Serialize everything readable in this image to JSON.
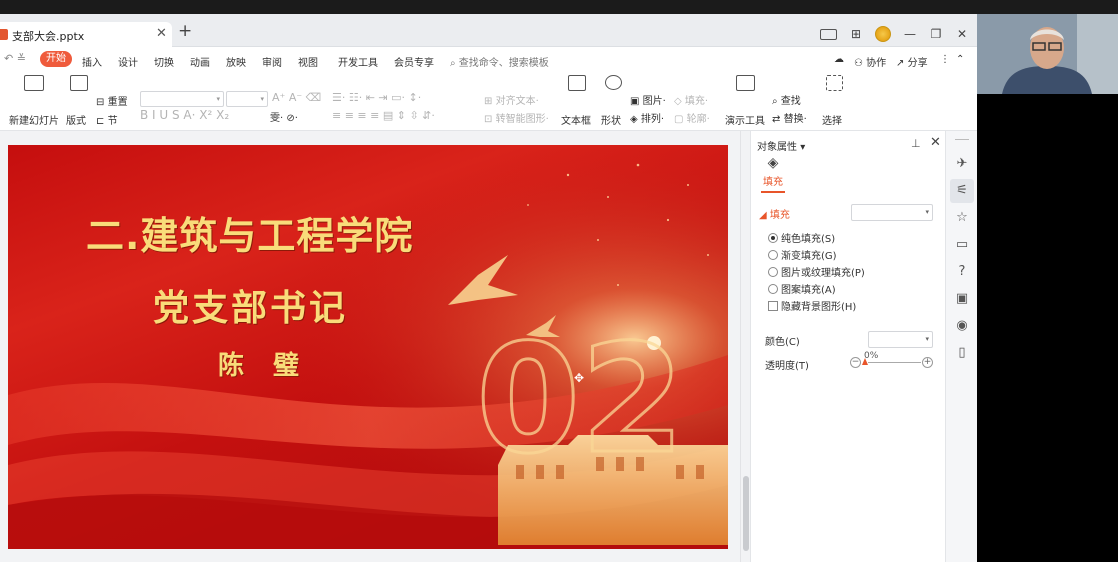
{
  "app": {
    "accent": "#ef5b3c",
    "slide_red": "#c50e0e",
    "slide_gold": "#f9dc7a"
  },
  "tab": {
    "title": "支部大会.pptx",
    "close": "✕",
    "add": "+"
  },
  "window_buttons": [
    "⬚",
    "⊞",
    "",
    "—",
    "❐",
    "✕"
  ],
  "menu": {
    "undo": "↶ ≚",
    "active": "开始",
    "items": [
      "插入",
      "设计",
      "切换",
      "动画",
      "放映",
      "审阅",
      "视图",
      "开发工具",
      "会员专享"
    ],
    "search": "查找命令、搜索模板",
    "right": [
      "协作",
      "分享"
    ]
  },
  "ribbon": {
    "new_slide": "新建幻灯片",
    "layout": "版式",
    "reset": "重置",
    "section": "节",
    "align_text": "对齐文本",
    "smartart": "转智能图形",
    "textbox": "文本框",
    "shape": "形状",
    "picture": "图片",
    "fill": "填充",
    "arrange": "排列",
    "outline": "轮廓",
    "presentation_tools": "演示工具",
    "find": "查找",
    "replace": "替换",
    "select": "选择"
  },
  "slide": {
    "title": "二.建筑与工程学院",
    "subtitle": "党支部书记",
    "name": "陈 璧",
    "number": "02"
  },
  "pane": {
    "title": "对象属性",
    "tab": "填充",
    "section": "填充",
    "options": [
      {
        "label": "纯色填充(S)",
        "selected": true
      },
      {
        "label": "渐变填充(G)",
        "selected": false
      },
      {
        "label": "图片或纹理填充(P)",
        "selected": false
      },
      {
        "label": "图案填充(A)",
        "selected": false
      }
    ],
    "hide_bg": "隐藏背景图形(H)",
    "color_label": "颜色(C)",
    "transparency_label": "透明度(T)",
    "transparency_value": "0%",
    "transparency_fraction": 0
  },
  "rail_icons": [
    "pin-icon",
    "sliders-icon",
    "star-icon",
    "comment-icon",
    "help-icon",
    "image-settings-icon",
    "location-icon",
    "book-icon"
  ]
}
